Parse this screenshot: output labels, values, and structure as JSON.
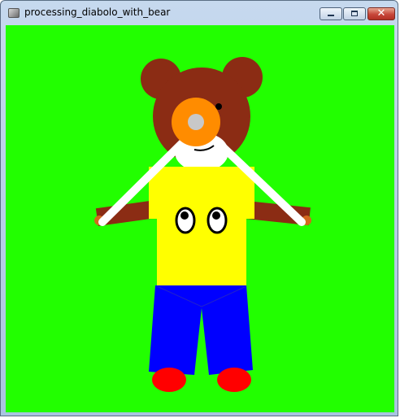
{
  "window": {
    "title": "processing_diabolo_with_bear",
    "icon": "processing-app-icon",
    "controls": {
      "minimize_icon": "minimize-icon",
      "maximize_icon": "maximize-icon",
      "close_icon": "close-icon",
      "close_glyph": "✕"
    }
  },
  "sketch": {
    "background_color": "#22ff00",
    "bear_color": "#8b2c14",
    "shirt_color": "#ffff00",
    "pants_color": "#0000ff",
    "shoe_color": "#ff0000",
    "diabolo_color": "#ff8c00",
    "diabolo_center_color": "#c8c8c8",
    "stick_color": "#ffffff"
  }
}
